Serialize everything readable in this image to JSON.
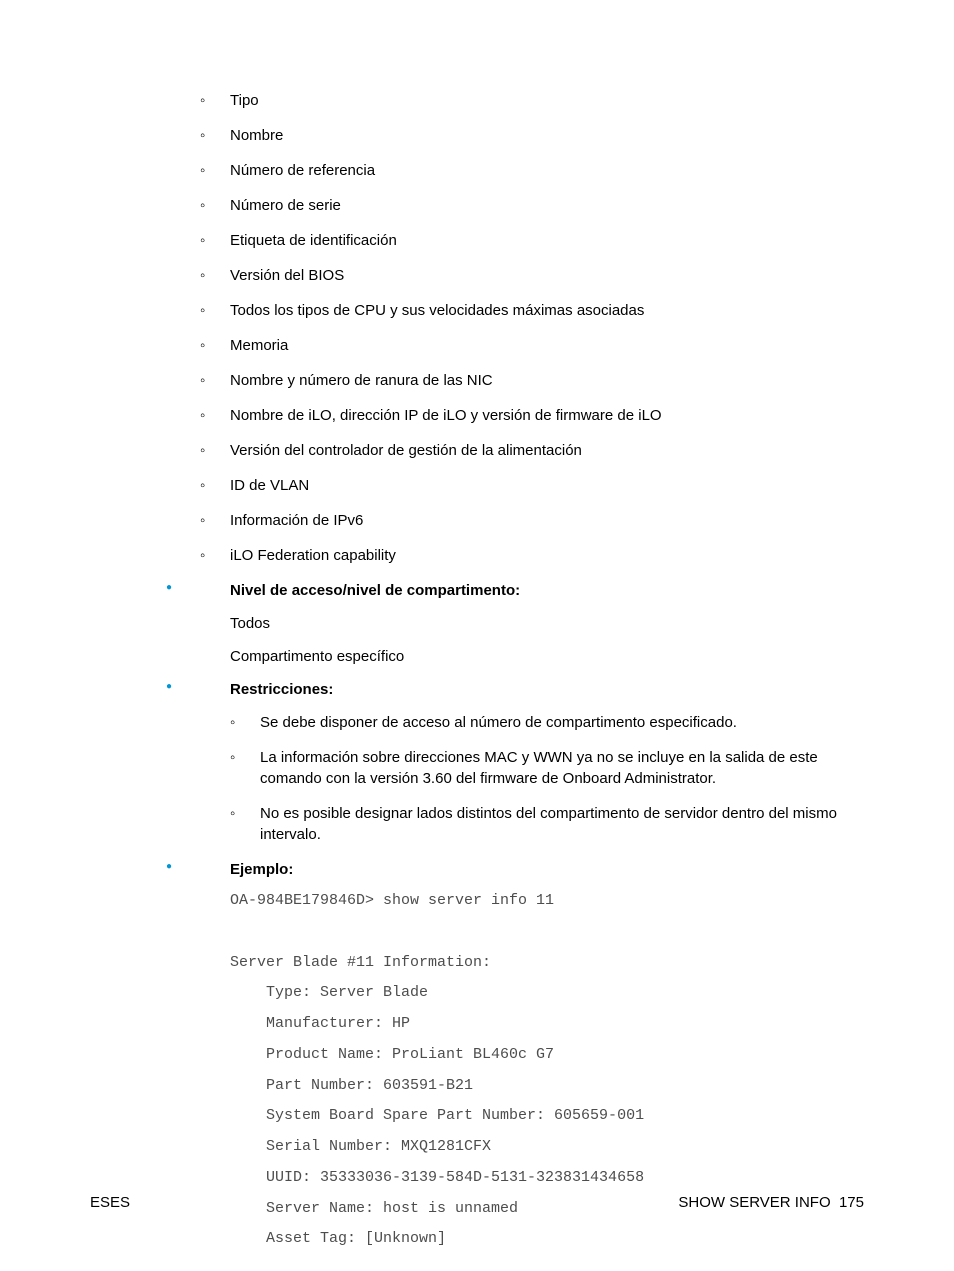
{
  "info_fields": [
    "Tipo",
    "Nombre",
    "Número de referencia",
    "Número de serie",
    "Etiqueta de identificación",
    "Versión del BIOS",
    "Todos los tipos de CPU y sus velocidades máximas asociadas",
    "Memoria",
    "Nombre y número de ranura de las NIC",
    "Nombre de iLO, dirección IP de iLO y versión de firmware de iLO",
    "Versión del controlador de gestión de la alimentación",
    "ID de VLAN",
    "Información de IPv6",
    "iLO Federation capability"
  ],
  "sections": {
    "access_level": {
      "heading": "Nivel de acceso/nivel de compartimento:",
      "line1": "Todos",
      "line2": "Compartimento específico"
    },
    "restrictions": {
      "heading": "Restricciones:",
      "items": [
        "Se debe disponer de acceso al número de compartimento especificado.",
        "La información sobre direcciones MAC y WWN ya no se incluye en la salida de este comando con la versión 3.60 del firmware de Onboard Administrator.",
        "No es posible designar lados distintos del compartimento de servidor dentro del mismo intervalo."
      ]
    },
    "example": {
      "heading": "Ejemplo:",
      "code": "OA-984BE179846D> show server info 11\n\nServer Blade #11 Information:\n    Type: Server Blade\n    Manufacturer: HP\n    Product Name: ProLiant BL460c G7\n    Part Number: 603591-B21\n    System Board Spare Part Number: 605659-001\n    Serial Number: MXQ1281CFX\n    UUID: 35333036-3139-584D-5131-323831434658\n    Server Name: host is unnamed\n    Asset Tag: [Unknown]"
    }
  },
  "footer": {
    "left": "ESES",
    "right_label": "SHOW SERVER INFO",
    "page_number": "175"
  }
}
